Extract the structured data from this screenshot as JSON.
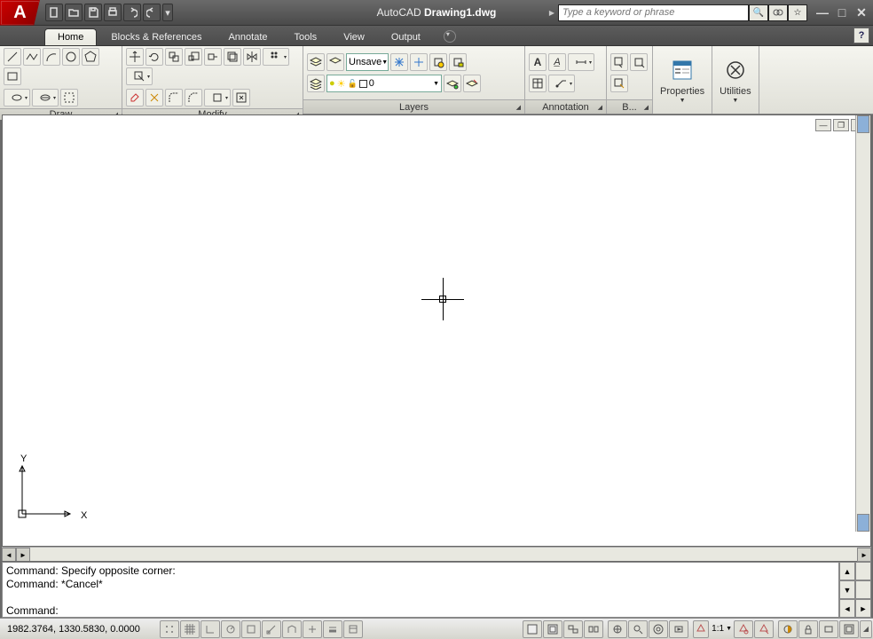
{
  "title": {
    "app": "AutoCAD",
    "file": "Drawing1.dwg"
  },
  "search": {
    "placeholder": "Type a keyword or phrase"
  },
  "tabs": {
    "home": "Home",
    "blocks": "Blocks & References",
    "annotate": "Annotate",
    "tools": "Tools",
    "view": "View",
    "output": "Output"
  },
  "panels": {
    "draw": "Draw",
    "modify": "Modify",
    "layers": "Layers",
    "annotation": "Annotation",
    "block": "B...",
    "properties": "Properties",
    "utilities": "Utilities"
  },
  "layer": {
    "unsaved": "Unsave",
    "current": "0"
  },
  "command": {
    "line1": "Command: Specify opposite corner:",
    "line2": "Command: *Cancel*",
    "line3": "",
    "prompt": "Command:"
  },
  "status": {
    "coords": "1982.3764, 1330.5830, 0.0000",
    "scale": "1:1"
  },
  "ucs": {
    "x": "X",
    "y": "Y"
  }
}
